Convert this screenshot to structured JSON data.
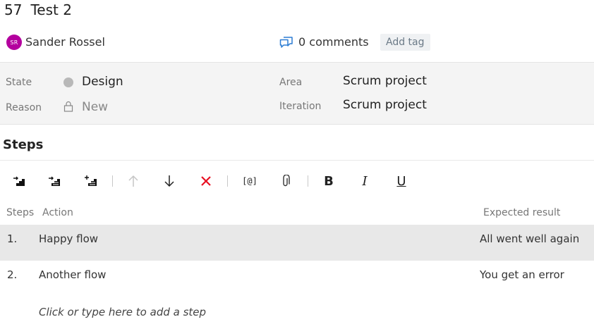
{
  "header": {
    "id": "57",
    "title": "Test 2"
  },
  "meta": {
    "avatar_initials": "SR",
    "assignee": "Sander Rossel",
    "comments_label": "0 comments",
    "add_tag_label": "Add tag"
  },
  "fields": {
    "state_label": "State",
    "state_value": "Design",
    "reason_label": "Reason",
    "reason_value": "New",
    "area_label": "Area",
    "area_value": "Scrum project",
    "iteration_label": "Iteration",
    "iteration_value": "Scrum project"
  },
  "steps_section": {
    "title": "Steps",
    "toolbar": {
      "insert_step_icon": "insert-step-icon",
      "insert_shared_steps_icon": "insert-shared-steps-icon",
      "create_shared_steps_icon": "create-shared-steps-icon",
      "move_up_icon": "arrow-up-icon",
      "move_down_icon": "arrow-down-icon",
      "delete_icon": "delete-x-icon",
      "parameter_label": "[@]",
      "attachment_icon": "paperclip-icon",
      "bold_label": "B",
      "italic_label": "I",
      "underline_label": "U"
    },
    "columns": {
      "steps": "Steps",
      "action": "Action",
      "expected": "Expected result"
    },
    "rows": [
      {
        "num": "1.",
        "action": "Happy flow",
        "expected": "All went well again",
        "selected": true
      },
      {
        "num": "2.",
        "action": "Another flow",
        "expected": "You get an error",
        "selected": false
      }
    ],
    "add_step_placeholder": "Click or type here to add a step"
  },
  "colors": {
    "avatar": "#b4009e",
    "comment_icon": "#2b7cd3",
    "delete_icon": "#e81123",
    "selected_row": "#e8e8e8",
    "fields_panel": "#f4f4f4"
  }
}
